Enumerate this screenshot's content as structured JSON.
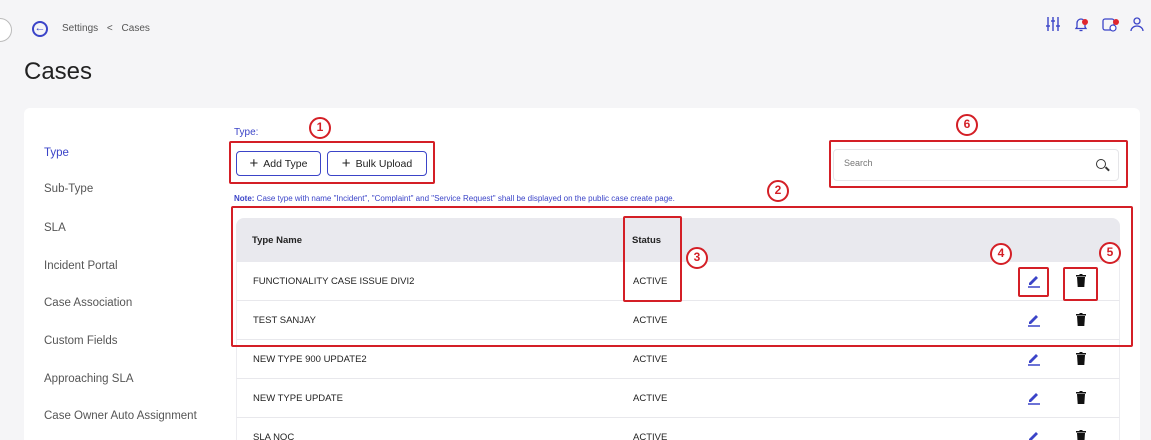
{
  "header": {
    "breadcrumb": [
      "Settings",
      "<",
      "Cases"
    ],
    "title": "Cases",
    "icons": [
      "filter-sliders-icon",
      "notification-bell-icon",
      "calendar-alert-icon",
      "user-icon"
    ],
    "notification_color": "#e0262d"
  },
  "sidebar": {
    "items": [
      {
        "label": "Type",
        "active": true
      },
      {
        "label": "Sub-Type"
      },
      {
        "label": "SLA"
      },
      {
        "label": "Incident Portal"
      },
      {
        "label": "Case Association"
      },
      {
        "label": "Custom Fields"
      },
      {
        "label": "Approaching SLA"
      },
      {
        "label": "Case Owner Auto Assignment"
      }
    ]
  },
  "main": {
    "type_label": "Type:",
    "buttons": {
      "add_type": "Add Type",
      "bulk_upload": "Bulk Upload",
      "plus": "+"
    },
    "note_prefix": "Note:",
    "note_text": " Case type with name \"Incident\", \"Complaint\" and \"Service Request\" shall be displayed on the public case create page.",
    "search": {
      "placeholder": "Search"
    },
    "table": {
      "columns": [
        "Type Name",
        "Status"
      ],
      "rows": [
        {
          "name": "FUNCTIONALITY CASE ISSUE DIVI2",
          "status": "ACTIVE"
        },
        {
          "name": "TEST SANJAY",
          "status": "ACTIVE"
        },
        {
          "name": "NEW TYPE 900 UPDATE2",
          "status": "ACTIVE"
        },
        {
          "name": "NEW TYPE UPDATE",
          "status": "ACTIVE"
        },
        {
          "name": "SLA NOC",
          "status": "ACTIVE"
        }
      ]
    }
  },
  "annotations": {
    "labels": [
      "1",
      "2",
      "3",
      "4",
      "5",
      "6"
    ],
    "color": "#d41f26"
  },
  "colors": {
    "accent": "#3b44c8",
    "background": "#f5f5f7"
  }
}
